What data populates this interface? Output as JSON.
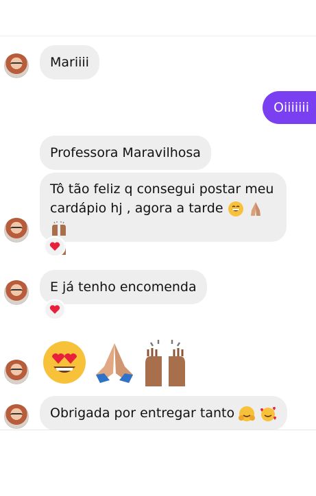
{
  "messages": {
    "m1": "Mariiii",
    "m2": "Oiiiiiii",
    "m3": "Professora Maravilhosa",
    "m4": "Tô tão feliz q consegui postar meu cardápio hj , agora a tarde",
    "m5": "E já tenho encomenda",
    "m7": "Obrigada por entregar tanto"
  },
  "emojis": {
    "m4_trailing": [
      "grinning-face",
      "folded-hands",
      "raising-hands",
      "raising-hands"
    ],
    "m6_large": [
      "heart-eyes",
      "folded-hands",
      "raising-hands"
    ],
    "m7_trailing": [
      "hugging-face",
      "smiling-face-with-hearts"
    ]
  },
  "reactions": {
    "m4": "red-heart",
    "m5": "red-heart"
  },
  "colors": {
    "outgoing_bubble": "#7b3ff2",
    "incoming_bubble": "#eeeeef",
    "heart": "#e8213a"
  }
}
